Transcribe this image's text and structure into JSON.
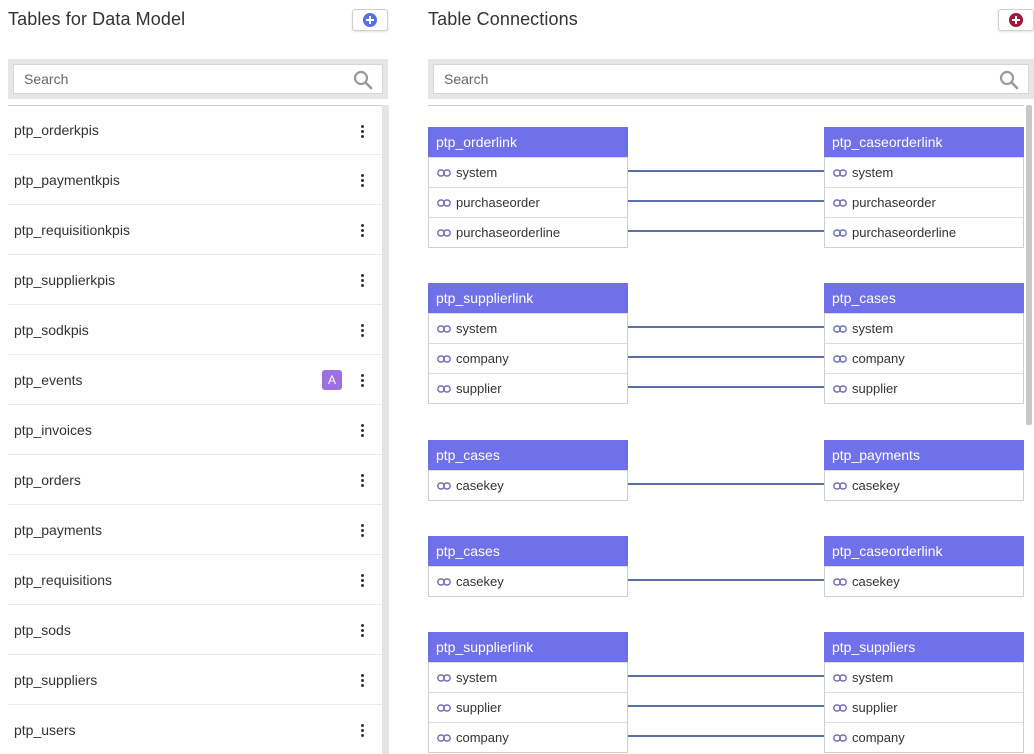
{
  "colors": {
    "accent_blue": "#7070e8",
    "add_table_icon": "#5b6ee1",
    "add_connection_icon": "#a0183a",
    "badge": "#9d6fe0",
    "connector_line": "#5b6fa8"
  },
  "left_panel": {
    "title": "Tables for Data Model",
    "add_button_icon": "plus-circle-icon",
    "search": {
      "placeholder": "Search",
      "value": ""
    },
    "tables": [
      {
        "name": "ptp_orderkpis",
        "badge": ""
      },
      {
        "name": "ptp_paymentkpis",
        "badge": ""
      },
      {
        "name": "ptp_requisitionkpis",
        "badge": ""
      },
      {
        "name": "ptp_supplierkpis",
        "badge": ""
      },
      {
        "name": "ptp_sodkpis",
        "badge": ""
      },
      {
        "name": "ptp_events",
        "badge": "A"
      },
      {
        "name": "ptp_invoices",
        "badge": ""
      },
      {
        "name": "ptp_orders",
        "badge": ""
      },
      {
        "name": "ptp_payments",
        "badge": ""
      },
      {
        "name": "ptp_requisitions",
        "badge": ""
      },
      {
        "name": "ptp_sods",
        "badge": ""
      },
      {
        "name": "ptp_suppliers",
        "badge": ""
      },
      {
        "name": "ptp_users",
        "badge": ""
      }
    ]
  },
  "right_panel": {
    "title": "Table Connections",
    "add_button_icon": "plus-circle-icon",
    "search": {
      "placeholder": "Search",
      "value": ""
    },
    "connections": [
      {
        "left": {
          "table": "ptp_orderlink",
          "columns": [
            "system",
            "purchaseorder",
            "purchaseorderline"
          ]
        },
        "right": {
          "table": "ptp_caseorderlink",
          "columns": [
            "system",
            "purchaseorder",
            "purchaseorderline"
          ]
        }
      },
      {
        "left": {
          "table": "ptp_supplierlink",
          "columns": [
            "system",
            "company",
            "supplier"
          ]
        },
        "right": {
          "table": "ptp_cases",
          "columns": [
            "system",
            "company",
            "supplier"
          ]
        }
      },
      {
        "left": {
          "table": "ptp_cases",
          "columns": [
            "casekey"
          ]
        },
        "right": {
          "table": "ptp_payments",
          "columns": [
            "casekey"
          ]
        }
      },
      {
        "left": {
          "table": "ptp_cases",
          "columns": [
            "casekey"
          ]
        },
        "right": {
          "table": "ptp_caseorderlink",
          "columns": [
            "casekey"
          ]
        }
      },
      {
        "left": {
          "table": "ptp_supplierlink",
          "columns": [
            "system",
            "supplier",
            "company"
          ]
        },
        "right": {
          "table": "ptp_suppliers",
          "columns": [
            "system",
            "supplier",
            "company"
          ]
        }
      }
    ]
  }
}
